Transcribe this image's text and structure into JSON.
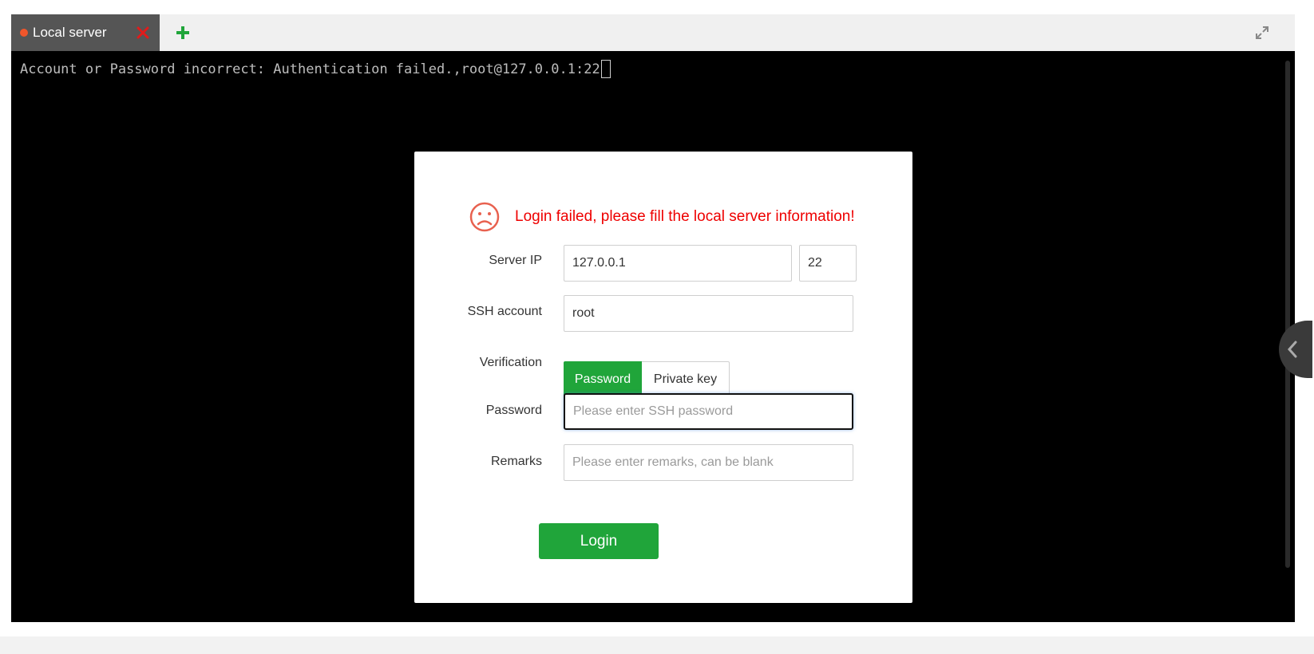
{
  "tabs": [
    {
      "label": "Local server",
      "status_color": "#f0562b",
      "active": true
    }
  ],
  "terminal": {
    "message": "Account or Password incorrect: Authentication failed.,root@127.0.0.1:22"
  },
  "dialog": {
    "error_icon": "sad-face-icon",
    "error_message": "Login failed, please fill the local server information!",
    "server_ip": {
      "label": "Server IP",
      "value": "127.0.0.1",
      "port": "22"
    },
    "ssh_account": {
      "label": "SSH account",
      "value": "root"
    },
    "verification": {
      "label": "Verification",
      "options": [
        "Password",
        "Private key"
      ],
      "selected": "Password"
    },
    "password": {
      "label": "Password",
      "placeholder": "Please enter SSH password",
      "value": ""
    },
    "remarks": {
      "label": "Remarks",
      "placeholder": "Please enter remarks, can be blank",
      "value": ""
    },
    "login_label": "Login"
  },
  "colors": {
    "accent": "#20a53a",
    "error": "#ee0000",
    "close": "#e01b1b"
  }
}
